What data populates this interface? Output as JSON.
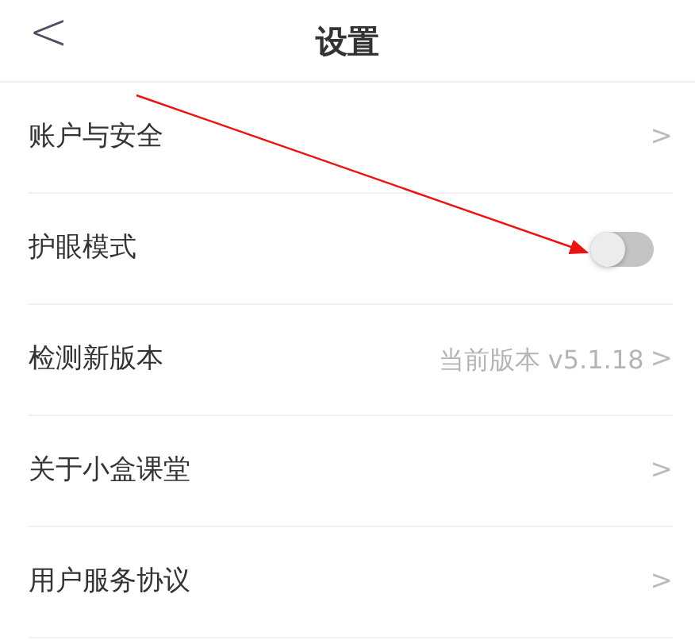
{
  "header": {
    "back": "<",
    "title": "设置"
  },
  "items": [
    {
      "kind": "link",
      "label": "账户与安全",
      "chevron": ">"
    },
    {
      "kind": "toggle",
      "label": "护眼模式",
      "on": false
    },
    {
      "kind": "link",
      "label": "检测新版本",
      "value": "当前版本 v5.1.18",
      "chevron": ">"
    },
    {
      "kind": "link",
      "label": "关于小盒课堂",
      "chevron": ">"
    },
    {
      "kind": "link",
      "label": "用户服务协议",
      "chevron": ">"
    }
  ]
}
